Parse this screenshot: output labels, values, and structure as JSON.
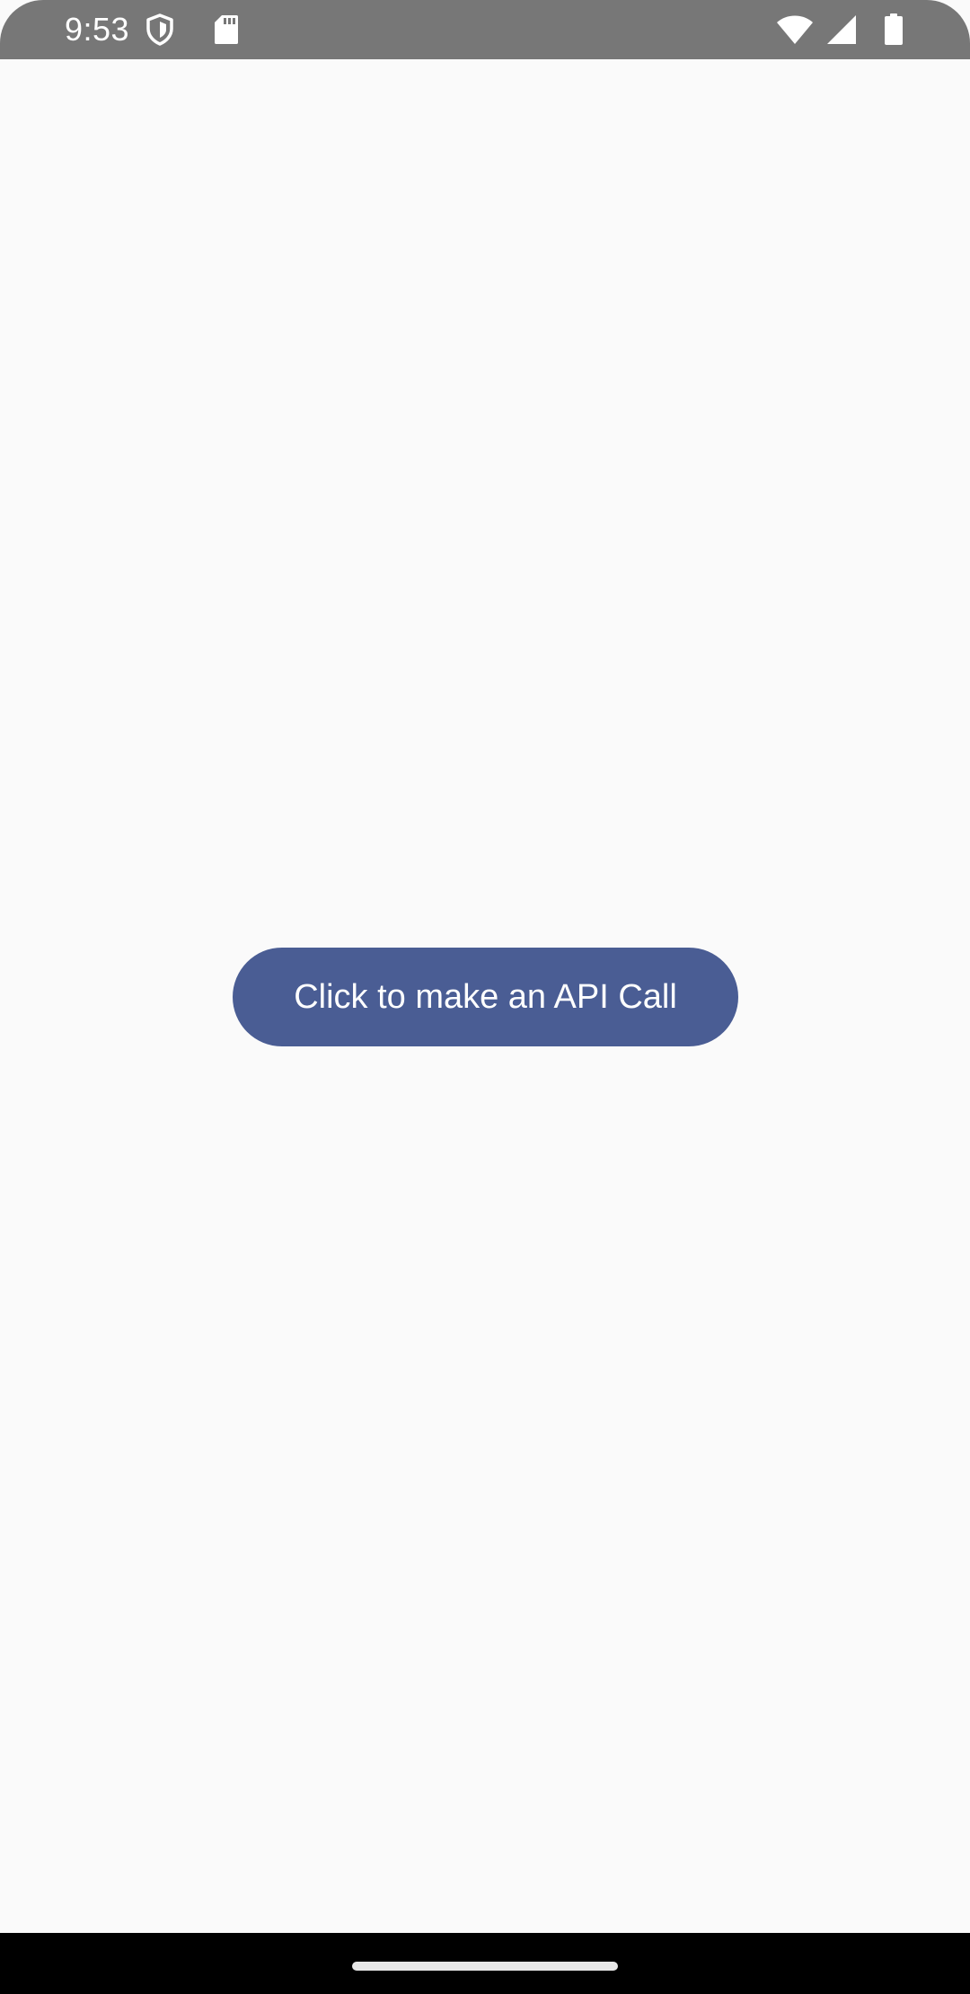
{
  "status_bar": {
    "time": "9:53",
    "icons": [
      "shield-icon",
      "sd-card-icon",
      "wifi-icon",
      "signal-icon",
      "battery-icon"
    ]
  },
  "main": {
    "button_label": "Click to make an API Call"
  },
  "colors": {
    "status_bar": "#777777",
    "background": "#fafafa",
    "button": "#4a5d94",
    "button_text": "#ffffff",
    "nav_bar": "#000000"
  }
}
